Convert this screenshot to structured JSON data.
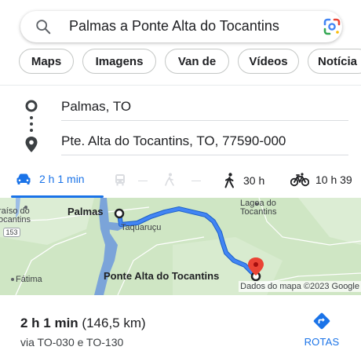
{
  "search": {
    "query": "Palmas a Ponte Alta do Tocantins",
    "icon": "search-icon",
    "lens_icon": "google-lens-icon"
  },
  "chips": [
    "Maps",
    "Imagens",
    "Van de",
    "Vídeos",
    "Notícia"
  ],
  "directions": {
    "origin": "Palmas, TO",
    "destination": "Pte. Alta do Tocantins, TO, 77590-000"
  },
  "modes": {
    "car": {
      "label": "2 h 1 min",
      "icon": "car-icon"
    },
    "transit": {
      "icon": "transit-icon"
    },
    "walk": {
      "label": "30 h",
      "icon": "walk-icon"
    },
    "bike": {
      "label": "10 h 39",
      "icon": "bicycle-icon"
    }
  },
  "map": {
    "labels": {
      "paraiso": "raíso do",
      "tocantins_left": "ocantins",
      "shield": "153",
      "palmas": "Palmas",
      "taquarucu": "Taquaruçu",
      "lagoa": "Lagoa do",
      "lagoa2": "Tocantins",
      "fatima": "Fátima",
      "ponte_alta": "Ponte Alta do Tocantins"
    },
    "attribution": "Dados do mapa ©2023 Google",
    "route_color": "#4285f4",
    "water_color": "#7ba4d9"
  },
  "summary": {
    "time": "2 h 1 min",
    "distance": "(146,5 km)",
    "via": "via TO-030 e TO-130",
    "rotas_label": "ROTAS"
  },
  "colors": {
    "accent": "#1a73e8",
    "map_green": "#cfe6c4"
  }
}
